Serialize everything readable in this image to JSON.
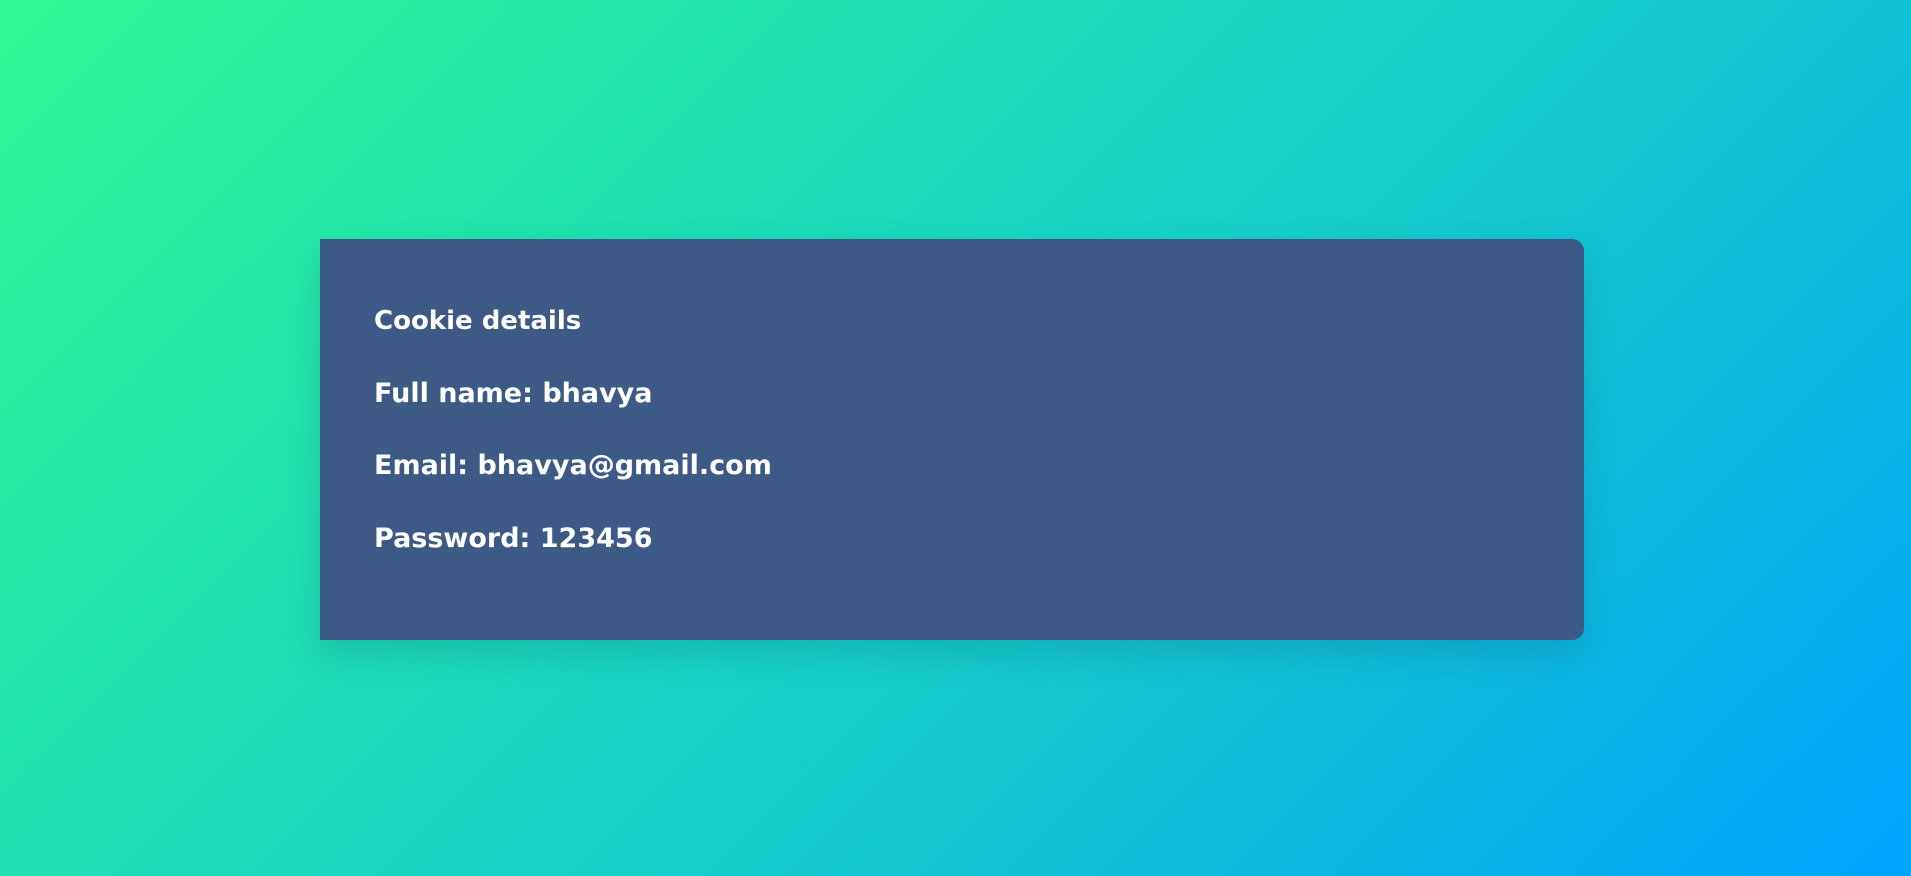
{
  "card": {
    "title": "Cookie details",
    "full_name_line": "Full name: bhavya",
    "email_line": "Email: bhavya@gmail.com",
    "password_line": "Password: 123456"
  },
  "colors": {
    "card_background": "#3d5985",
    "gradient_start": "#2ff996",
    "gradient_end": "#00a3ff",
    "text": "#ffffff"
  }
}
